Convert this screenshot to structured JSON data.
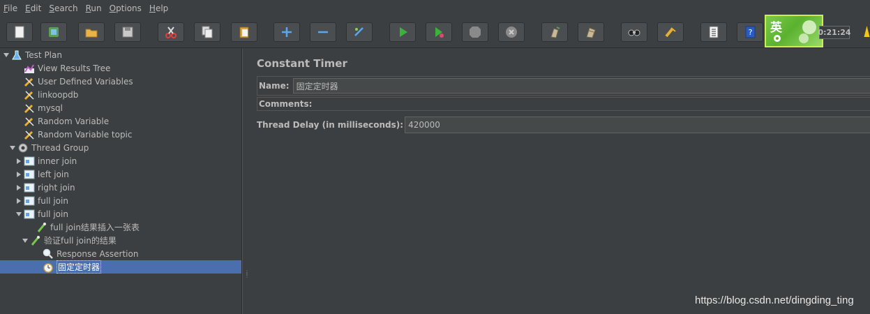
{
  "menu": [
    {
      "mnemonic": "F",
      "rest": "ile"
    },
    {
      "mnemonic": "E",
      "rest": "dit"
    },
    {
      "mnemonic": "S",
      "rest": "earch"
    },
    {
      "mnemonic": "R",
      "rest": "un"
    },
    {
      "mnemonic": "O",
      "rest": "ptions"
    },
    {
      "mnemonic": "H",
      "rest": "elp"
    }
  ],
  "toolbar": {
    "buttons": [
      "new-icon",
      "templates-icon",
      "open-icon",
      "save-icon",
      "cut-icon",
      "copy-icon",
      "paste-icon",
      "expand-icon",
      "collapse-icon",
      "toggle-icon",
      "start-icon",
      "start-no-pause-icon",
      "stop-icon",
      "shutdown-icon",
      "clear-icon",
      "clear-all-icon",
      "search-icon",
      "reset-search-icon",
      "function-helper-icon",
      "help-icon"
    ],
    "elapsed_time": "0:21:24",
    "ime_char": "英"
  },
  "tree": [
    {
      "label": "Test Plan",
      "icon": "flask-icon",
      "arrow": "down",
      "depth": 0
    },
    {
      "label": "View Results Tree",
      "icon": "chart-icon",
      "arrow": "",
      "depth": 2
    },
    {
      "label": "User Defined Variables",
      "icon": "wrench-icon",
      "arrow": "",
      "depth": 2
    },
    {
      "label": "linkoopdb",
      "icon": "wrench-icon",
      "arrow": "",
      "depth": 2
    },
    {
      "label": "mysql",
      "icon": "wrench-icon",
      "arrow": "",
      "depth": 2
    },
    {
      "label": "Random Variable",
      "icon": "wrench-icon",
      "arrow": "",
      "depth": 2
    },
    {
      "label": "Random Variable topic",
      "icon": "wrench-icon",
      "arrow": "",
      "depth": 2
    },
    {
      "label": "Thread Group",
      "icon": "gear-icon",
      "arrow": "down",
      "depth": 1
    },
    {
      "label": "inner join",
      "icon": "controller-icon",
      "arrow": "right",
      "depth": 2
    },
    {
      "label": "left join",
      "icon": "controller-icon",
      "arrow": "right",
      "depth": 2
    },
    {
      "label": "right join",
      "icon": "controller-icon",
      "arrow": "right",
      "depth": 2
    },
    {
      "label": "full join",
      "icon": "controller-icon",
      "arrow": "right",
      "depth": 2
    },
    {
      "label": "full join",
      "icon": "controller-icon",
      "arrow": "down",
      "depth": 2
    },
    {
      "label": "full join结果插入一张表",
      "icon": "pipette-icon",
      "arrow": "",
      "depth": 4
    },
    {
      "label": "验证full join的结果",
      "icon": "pipette-icon",
      "arrow": "down",
      "depth": 3
    },
    {
      "label": "Response Assertion",
      "icon": "magnifier-icon",
      "arrow": "",
      "depth": 5
    },
    {
      "label": "固定定时器",
      "icon": "stopwatch-icon",
      "arrow": "",
      "depth": 5,
      "selected": true
    }
  ],
  "panel": {
    "title": "Constant Timer",
    "name_label": "Name:",
    "name_value": "固定定时器",
    "comments_label": "Comments:",
    "comments_value": "",
    "delay_label": "Thread Delay (in milliseconds):",
    "delay_value": "420000"
  },
  "watermark": "https://blog.csdn.net/dingding_ting"
}
